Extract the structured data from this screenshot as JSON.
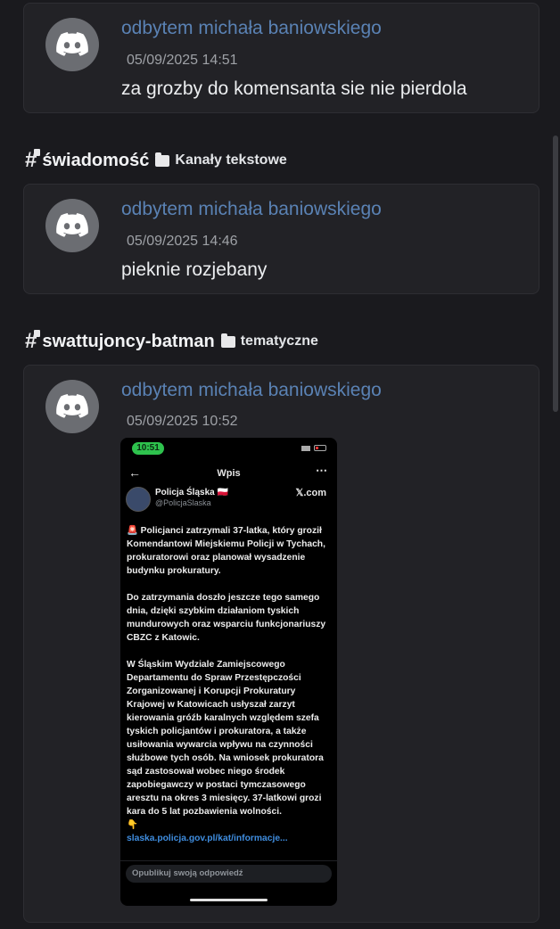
{
  "messages": [
    {
      "author": "odbytem michała baniowskiego",
      "timestamp": "05/09/2025 14:51",
      "text": "za grozby do komensanta sie nie pierdola"
    },
    {
      "channel": "świadomość",
      "category": "Kanały tekstowe",
      "author": "odbytem michała baniowskiego",
      "timestamp": "05/09/2025 14:46",
      "text": "pieknie rozjebany"
    },
    {
      "channel": "swattujoncy-batman",
      "category": "tematyczne",
      "author": "odbytem michała baniowskiego",
      "timestamp": "05/09/2025 10:52"
    }
  ],
  "screenshot": {
    "status_time": "10:51",
    "top_title": "Wpis",
    "account_name": "Policja Śląska 🇵🇱",
    "account_handle": "@PolicjaSlaska",
    "platform": "𝕏.com",
    "paragraphs": [
      "🚨 Policjanci zatrzymali 37-latka, który groził Komendantowi Miejskiemu Policji w Tychach, prokuratorowi oraz planował wysadzenie budynku prokuratury.",
      "Do zatrzymania doszło jeszcze tego samego dnia, dzięki szybkim działaniom tyskich mundurowych oraz wsparciu funkcjonariuszy CBZC z Katowic.",
      "W Śląskim Wydziale Zamiejscowego Departamentu do Spraw Przestępczości Zorganizowanej i Korupcji Prokuratury Krajowej w Katowicach usłyszał zarzyt kierowania gróźb karalnych względem szefa tyskich policjantów i prokuratora, a także usiłowania wywarcia wpływu na czynności służbowe tych osób. Na wniosek prokuratora sąd zastosował wobec niego środek zapobiegawczy w postaci tymczasowego aresztu na okres 3 miesięcy. 37-latkowi grozi kara do 5 lat pozbawienia wolności."
    ],
    "pointer_emoji": "👇",
    "link": "slaska.policja.gov.pl/kat/informacje...",
    "reply_placeholder": "Opublikuj swoją odpowiedź"
  },
  "icons": {
    "avatar": "discord-logo-icon",
    "channel": "hashtag-lock-icon",
    "category": "folder-icon"
  },
  "colors": {
    "background": "#1a1a1e",
    "card": "#222226",
    "author": "#5a82b4",
    "timestamp": "#9ea1a6",
    "status_pill": "#2ec24d",
    "link": "#3f8ddf"
  }
}
